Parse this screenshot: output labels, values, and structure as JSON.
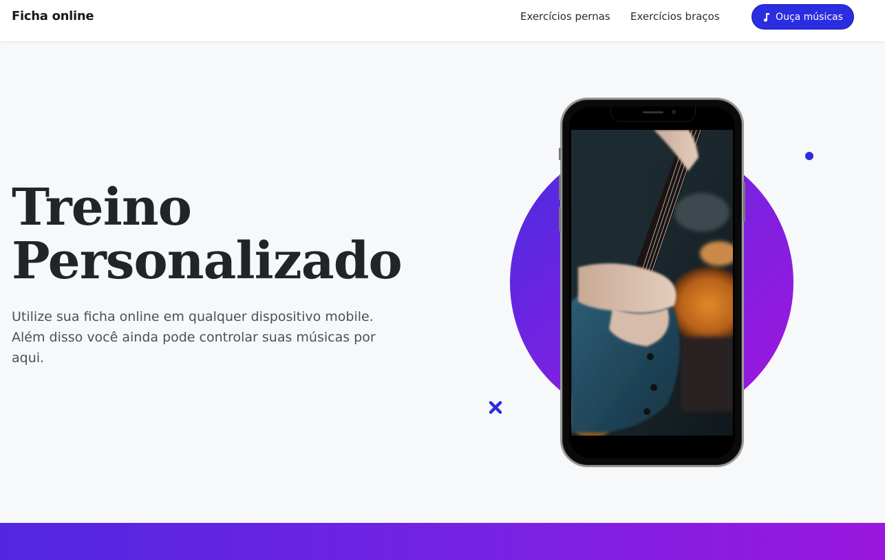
{
  "navbar": {
    "brand": "Ficha online",
    "links": [
      {
        "label": "Exercícios pernas"
      },
      {
        "label": "Exercícios braços"
      }
    ],
    "music_button": {
      "label": "Ouça músicas",
      "icon": "music-note-icon"
    }
  },
  "hero": {
    "title_line1": "Treino",
    "title_line2": "Personalizado",
    "description": "Utilize sua ficha online em qualquer dispositivo mobile. Além disso você ainda pode controlar suas músicas por aqui."
  },
  "colors": {
    "accent": "#2b2de0",
    "gradient_start": "#4a2be2",
    "gradient_end": "#a115dd",
    "background": "#f7f8fa"
  }
}
